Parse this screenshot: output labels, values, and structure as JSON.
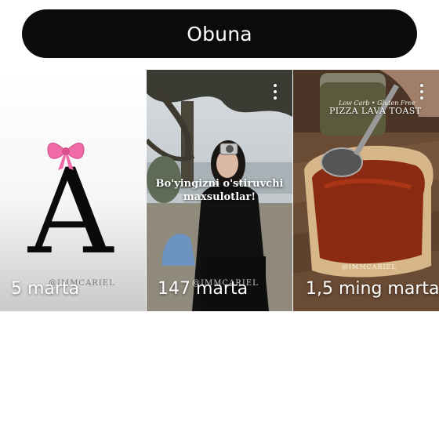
{
  "subscribe_button": {
    "label": "Obuna"
  },
  "cards": [
    {
      "views": "5 marta",
      "watermark": "@IMMCARIEL",
      "logo_letter": "A",
      "bow_color": "#ef6aa6"
    },
    {
      "views": "147 marta",
      "watermark": "@IMMCARIEL",
      "overlay_line1": "Bo'yingizni o'stiruvchi",
      "overlay_line2": "maxsulotlar!",
      "more_icon": "more-vert-icon"
    },
    {
      "views": "1,5 ming marta",
      "watermark": "@IMMCARIEL",
      "food_subtitle": "Low Carb • Gluten Free",
      "food_title": "PIZZA LAVA TOAST",
      "more_icon": "more-vert-icon"
    }
  ]
}
